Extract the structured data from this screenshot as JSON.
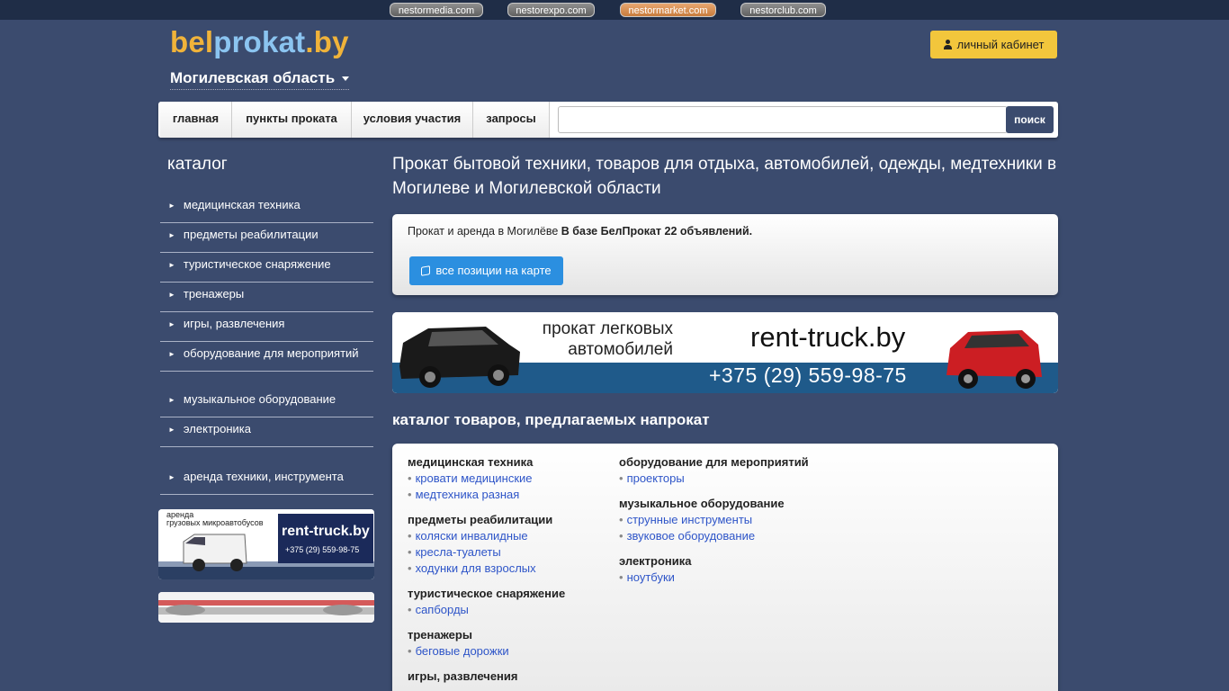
{
  "top_links": [
    {
      "label": "nestormedia.com",
      "active": false
    },
    {
      "label": "nestorexpo.com",
      "active": false
    },
    {
      "label": "nestormarket.com",
      "active": true
    },
    {
      "label": "nestorclub.com",
      "active": false
    }
  ],
  "logo": {
    "part1": "bel",
    "part2": "prokat",
    "part3": ".by"
  },
  "region": "Могилевская область",
  "cabinet_label": "личный кабинет",
  "nav": [
    "главная",
    "пункты проката",
    "условия участия",
    "запросы"
  ],
  "search": {
    "button": "поиск",
    "placeholder": ""
  },
  "sidebar": {
    "title": "каталог",
    "items": [
      "медицинская техника",
      "предметы реабилитации",
      "туристическое снаряжение",
      "тренажеры",
      "игры, развлечения",
      "оборудование для мероприятий",
      "музыкальное оборудование",
      "электроника",
      "аренда техники, инструмента"
    ],
    "banner1": {
      "line1": "аренда",
      "line2": "грузовых микроавтобусов",
      "site": "rent-truck.by",
      "phone": "+375 (29) 559-98-75"
    }
  },
  "main": {
    "title": "Прокат бытовой техники, товаров для отдыха, автомобилей, одежды, медтехники в Могилеве и Могилевской области",
    "info_text": "Прокат и аренда в Могилёве",
    "info_bold": "В базе БелПрокат 22 объявлений.",
    "map_button": "все позиции на карте",
    "banner": {
      "line1": "прокат легковых",
      "line2": "автомобилей",
      "site": "rent-truck.by",
      "phone": "+375 (29) 559-98-75"
    },
    "catalog_heading": "каталог товаров, предлагаемых напрокат"
  },
  "catalog": {
    "col1": [
      {
        "title": "медицинская техника",
        "items": [
          "кровати медицинские",
          "медтехника разная"
        ]
      },
      {
        "title": "предметы реабилитации",
        "items": [
          "коляски инвалидные",
          "кресла-туалеты",
          "ходунки для взрослых"
        ]
      },
      {
        "title": "туристическое снаряжение",
        "items": [
          "сапборды"
        ]
      },
      {
        "title": "тренажеры",
        "items": [
          "беговые дорожки"
        ]
      },
      {
        "title": "игры, развлечения",
        "items": []
      }
    ],
    "col2": [
      {
        "title": "оборудование для мероприятий",
        "items": [
          "проекторы"
        ]
      },
      {
        "title": "музыкальное оборудование",
        "items": [
          "струнные инструменты",
          "звуковое оборудование"
        ]
      },
      {
        "title": "электроника",
        "items": [
          "ноутбуки"
        ]
      }
    ]
  },
  "colors": {
    "background": "#3b4b6e",
    "accent_yellow": "#f2c63c",
    "button_blue": "#2b8fe0",
    "link_blue": "#2e55c8"
  }
}
